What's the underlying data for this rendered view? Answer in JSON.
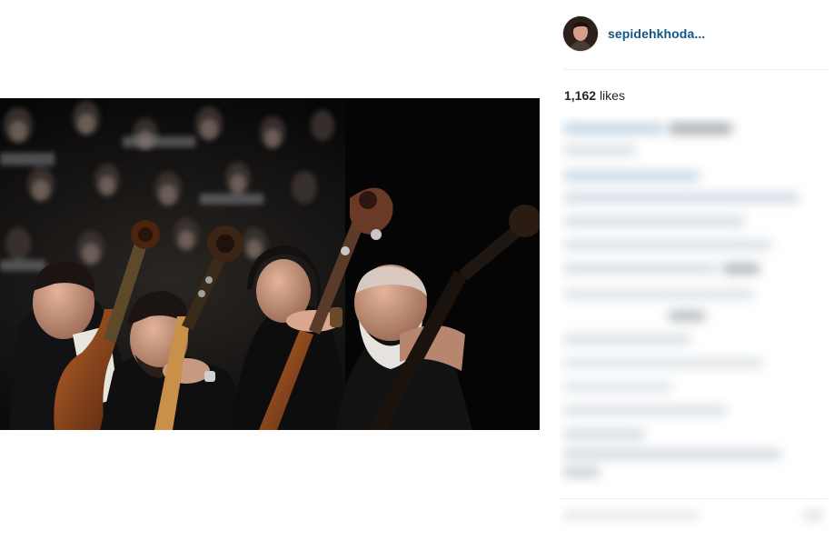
{
  "post": {
    "username": "sepidehkhoda...",
    "likes_count": "1,162",
    "likes_word": "likes"
  },
  "icons": {
    "avatar": "profile-photo",
    "photo": "orchestra-double-bass-players"
  }
}
